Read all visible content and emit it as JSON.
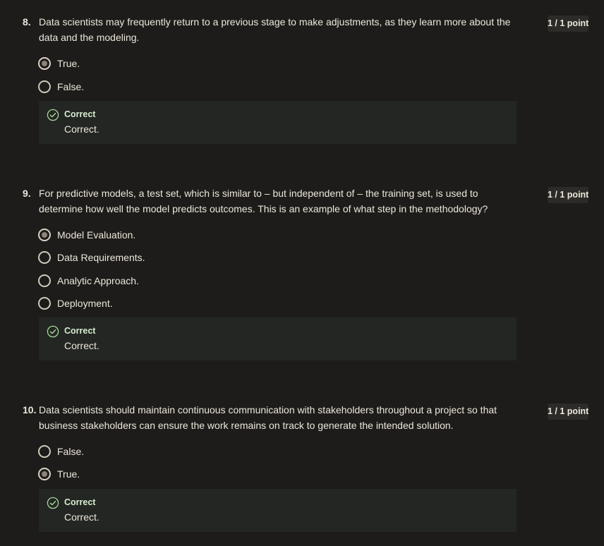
{
  "questions": [
    {
      "number": "8.",
      "text": "Data scientists may frequently return to a previous stage to make adjustments, as they learn more about the data and the modeling.",
      "points": "1 / 1 point",
      "options": [
        {
          "label": "True.",
          "selected": true
        },
        {
          "label": "False.",
          "selected": false
        }
      ],
      "feedback": {
        "title": "Correct",
        "text": "Correct."
      }
    },
    {
      "number": "9.",
      "text": "For predictive models, a test set, which is similar to – but independent of – the training set, is used to determine how well the model predicts outcomes. This is an example of what step in the methodology?",
      "points": "1 / 1 point",
      "options": [
        {
          "label": "Model Evaluation.",
          "selected": true
        },
        {
          "label": "Data Requirements.",
          "selected": false
        },
        {
          "label": "Analytic Approach.",
          "selected": false
        },
        {
          "label": "Deployment.",
          "selected": false
        }
      ],
      "feedback": {
        "title": "Correct",
        "text": "Correct."
      }
    },
    {
      "number": "10.",
      "text": "Data scientists should maintain continuous communication with stakeholders throughout a project so that business stakeholders can ensure the work remains on track to generate the intended solution.",
      "points": "1 / 1 point",
      "options": [
        {
          "label": "False.",
          "selected": false
        },
        {
          "label": "True.",
          "selected": true
        }
      ],
      "feedback": {
        "title": "Correct",
        "text": "Correct."
      }
    }
  ],
  "colors": {
    "background": "#1e1c1a",
    "feedback_background": "#232622",
    "correct_green": "#a6d59a",
    "text": "#ece7dc"
  },
  "icons": {
    "radio": "radio-icon",
    "feedback": "check-circle-icon"
  }
}
